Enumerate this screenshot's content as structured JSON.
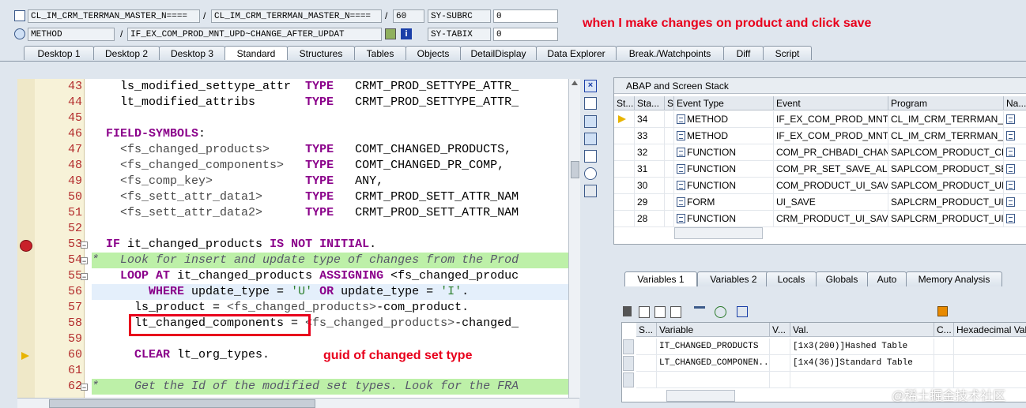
{
  "header": {
    "row1": {
      "field1": "CL_IM_CRM_TERRMAN_MASTER_N====",
      "sep1": "/",
      "field2": "CL_IM_CRM_TERRMAN_MASTER_N====",
      "sep2": "/",
      "line_no": "60",
      "sysvar_name": "SY-SUBRC",
      "sysvar_value": "0"
    },
    "row2": {
      "field1": "METHOD",
      "sep1": "/",
      "field2": "IF_EX_COM_PROD_MNT_UPD~CHANGE_AFTER_UPDAT",
      "sysvar_name": "SY-TABIX",
      "sysvar_value": "0"
    }
  },
  "annotations": {
    "top": "when I make changes on product and click save",
    "middle": "guid of changed set type"
  },
  "tabs": [
    "Desktop 1",
    "Desktop 2",
    "Desktop 3",
    "Standard",
    "Structures",
    "Tables",
    "Objects",
    "DetailDisplay",
    "Data Explorer",
    "Break./Watchpoints",
    "Diff",
    "Script"
  ],
  "active_tab": "Standard",
  "code_lines": [
    {
      "n": "43",
      "t": "    ls_modified_settype_attr  TYPE   CRMT_PROD_SETTYPE_ATTR_"
    },
    {
      "n": "44",
      "t": "    lt_modified_attribs       TYPE   CRMT_PROD_SETTYPE_ATTR_"
    },
    {
      "n": "45",
      "t": ""
    },
    {
      "n": "46",
      "t": "  FIELD-SYMBOLS:"
    },
    {
      "n": "47",
      "t": "    <fs_changed_products>     TYPE   COMT_CHANGED_PRODUCTS,"
    },
    {
      "n": "48",
      "t": "    <fs_changed_components>   TYPE   COMT_CHANGED_PR_COMP,"
    },
    {
      "n": "49",
      "t": "    <fs_comp_key>             TYPE   ANY,"
    },
    {
      "n": "50",
      "t": "    <fs_sett_attr_data1>      TYPE   CRMT_PROD_SETT_ATTR_NAM"
    },
    {
      "n": "51",
      "t": "    <fs_sett_attr_data2>      TYPE   CRMT_PROD_SETT_ATTR_NAM"
    },
    {
      "n": "52",
      "t": ""
    },
    {
      "n": "53",
      "t": "  IF it_changed_products IS NOT INITIAL."
    },
    {
      "n": "54",
      "t": "*   Look for insert and update type of changes from the Prod"
    },
    {
      "n": "55",
      "t": "    LOOP AT it_changed_products ASSIGNING <fs_changed_produc"
    },
    {
      "n": "56",
      "t": "        WHERE update_type = 'U' OR update_type = 'I'."
    },
    {
      "n": "57",
      "t": "      ls_product = <fs_changed_products>-com_product."
    },
    {
      "n": "58",
      "t": "      lt_changed_components = <fs_changed_products>-changed_"
    },
    {
      "n": "59",
      "t": ""
    },
    {
      "n": "60",
      "t": "      CLEAR lt_org_types."
    },
    {
      "n": "61",
      "t": ""
    },
    {
      "n": "62",
      "t": "*     Get the Id of the modified set types. Look for the FRA"
    }
  ],
  "stack": {
    "title": "ABAP and Screen Stack",
    "columns": [
      "St...",
      "Sta...",
      "S..",
      "Event Type",
      "Event",
      "Program",
      "Na..."
    ],
    "rows": [
      {
        "level": "34",
        "type": "METHOD",
        "event": "IF_EX_COM_PROD_MNT...",
        "program": "CL_IM_CRM_TERRMAN_..."
      },
      {
        "level": "33",
        "type": "METHOD",
        "event": "IF_EX_COM_PROD_MNT...",
        "program": "CL_IM_CRM_TERRMAN_..."
      },
      {
        "level": "32",
        "type": "FUNCTION",
        "event": "COM_PR_CHBADI_CHAN...",
        "program": "SAPLCOM_PRODUCT_CH..."
      },
      {
        "level": "31",
        "type": "FUNCTION",
        "event": "COM_PR_SET_SAVE_ALL",
        "program": "SAPLCOM_PRODUCT_SET"
      },
      {
        "level": "30",
        "type": "FUNCTION",
        "event": "COM_PRODUCT_UI_SAVE",
        "program": "SAPLCOM_PRODUCT_UI..."
      },
      {
        "level": "29",
        "type": "FORM",
        "event": "UI_SAVE",
        "program": "SAPLCRM_PRODUCT_UI_..."
      },
      {
        "level": "28",
        "type": "FUNCTION",
        "event": "CRM_PRODUCT_UI_SAVE",
        "program": "SAPLCRM_PRODUCT_UI_..."
      }
    ]
  },
  "var_tabs": [
    "Variables 1",
    "Variables 2",
    "Locals",
    "Globals",
    "Auto",
    "Memory Analysis"
  ],
  "variables": {
    "columns": [
      "S...",
      "Variable",
      "V...",
      "Val.",
      "C...",
      "Hexadecimal Valu"
    ],
    "rows": [
      {
        "name": "IT_CHANGED_PRODUCTS",
        "value": "[1x3(200)]Hashed Table"
      },
      {
        "name": "LT_CHANGED_COMPONEN...",
        "value": "[1x4(36)]Standard Table"
      }
    ]
  },
  "watermark": "@稀土掘金技术社区",
  "colors": {
    "annotation": "#e8001c",
    "comment_bg": "#bdf0a8",
    "keyword": "#8a008a"
  }
}
